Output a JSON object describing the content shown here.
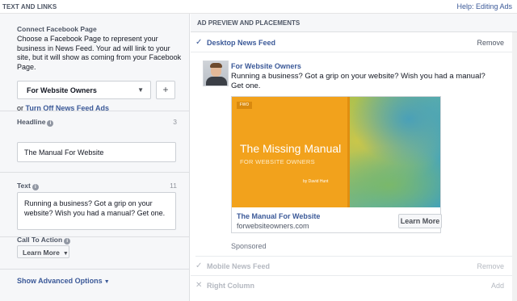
{
  "topbar": {
    "title": "TEXT AND LINKS",
    "help": "Help: Editing Ads"
  },
  "left": {
    "connect": {
      "label": "Connect Facebook Page",
      "description": "Choose a Facebook Page to represent your business in News Feed. Your ad will link to your site, but it will show as coming from your Facebook Page.",
      "selected_page": "For Website Owners",
      "add_symbol": "+",
      "turnoff_prefix": "or",
      "turnoff_link": "Turn Off News Feed Ads"
    },
    "headline": {
      "label": "Headline",
      "count": "3",
      "value": "The Manual For Website"
    },
    "text": {
      "label": "Text",
      "count": "11",
      "value": "Running a business? Got a grip on your website? Wish you had a manual? Get one."
    },
    "cta": {
      "label": "Call To Action",
      "value": "Learn More"
    },
    "advanced": "Show Advanced Options"
  },
  "right": {
    "header": "AD PREVIEW AND PLACEMENTS",
    "placements": [
      {
        "name": "Desktop News Feed",
        "action": "Remove",
        "state": "active"
      },
      {
        "name": "Mobile News Feed",
        "action": "Remove",
        "state": "dim"
      },
      {
        "name": "Right Column",
        "action": "Add",
        "state": "dim"
      }
    ],
    "preview": {
      "page_name": "For Website Owners",
      "post_text": "Running a business? Got a grip on your website? Wish you had a manual? Get one.",
      "image": {
        "logo": "FWO",
        "title": "The Missing Manual",
        "subtitle": "FOR WEBSITE OWNERS",
        "author": "by David Hunt"
      },
      "card_title": "The Manual For Website",
      "card_url": "forwebsiteowners.com",
      "cta": "Learn More",
      "sponsored": "Sponsored"
    }
  },
  "colors": {
    "link": "#3b5998",
    "book": "#f2a21c"
  }
}
